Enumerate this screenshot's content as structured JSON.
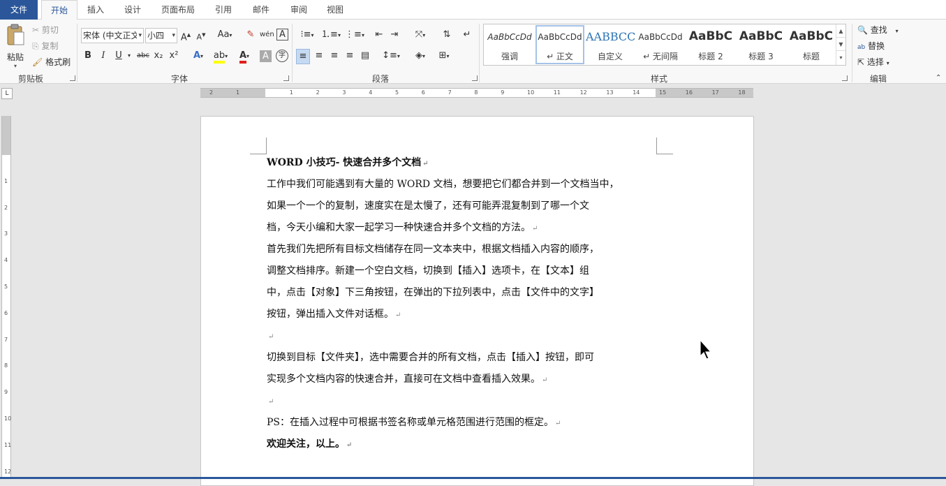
{
  "tabs": [
    {
      "label": "文件"
    },
    {
      "label": "开始"
    },
    {
      "label": "插入"
    },
    {
      "label": "设计"
    },
    {
      "label": "页面布局"
    },
    {
      "label": "引用"
    },
    {
      "label": "邮件"
    },
    {
      "label": "审阅"
    },
    {
      "label": "视图"
    }
  ],
  "clipboard": {
    "paste": "粘贴",
    "cut": "剪切",
    "copy": "复制",
    "format_painter": "格式刷",
    "label": "剪贴板"
  },
  "font": {
    "name": "宋体 (中文正文",
    "size": "小四",
    "label": "字体",
    "bold": "B",
    "italic": "I",
    "underline": "U",
    "strike": "abc",
    "sub": "x₂",
    "sup": "x²"
  },
  "paragraph": {
    "label": "段落"
  },
  "styles": {
    "label": "样式",
    "items": [
      {
        "preview": "AaBbCcDd",
        "name": "强调"
      },
      {
        "preview": "AaBbCcDd",
        "name": "↵ 正文"
      },
      {
        "preview": "AABBCC",
        "name": "自定义"
      },
      {
        "preview": "AaBbCcDd",
        "name": "↵ 无间隔"
      },
      {
        "preview": "AaBbC",
        "name": "标题 2"
      },
      {
        "preview": "AaBbC",
        "name": "标题 3"
      },
      {
        "preview": "AaBbC",
        "name": "标题"
      }
    ]
  },
  "editing": {
    "find": "查找",
    "replace": "替换",
    "select": "选择",
    "label": "编辑"
  },
  "ruler": {
    "h_numbers": [
      "2",
      "1",
      "1",
      "2",
      "3",
      "4",
      "5",
      "6",
      "7",
      "8",
      "9",
      "10",
      "11",
      "12",
      "13",
      "14",
      "15",
      "16",
      "17",
      "18"
    ],
    "v_numbers": [
      "1",
      "2",
      "3",
      "4",
      "5",
      "6",
      "7",
      "8",
      "9",
      "10",
      "11",
      "12"
    ]
  },
  "document": {
    "title": "WORD 小技巧- 快速合并多个文档",
    "lines": [
      "工作中我们可能遇到有大量的 WORD 文档，想要把它们都合并到一个文档当中，",
      "如果一个一个的复制，速度实在是太慢了，还有可能弄混复制到了哪一个文",
      "档，今天小编和大家一起学习一种快速合并多个文档的方法。",
      "首先我们先把所有目标文档储存在同一文本夹中，根据文档插入内容的顺序，",
      "调整文档排序。新建一个空白文档，切换到【插入】选项卡，在【文本】组",
      "中，点击【对象】下三角按钮，在弹出的下拉列表中，点击【文件中的文字】",
      "按钮，弹出插入文件对话框。",
      "",
      "切换到目标【文件夹】，选中需要合并的所有文档，点击【插入】按钮，即可",
      "实现多个文档内容的快速合并，直接可在文档中查看插入效果。",
      "",
      "PS：在插入过程中可根据书签名称或单元格范围进行范围的框定。",
      "欢迎关注，以上。"
    ],
    "mark_lines": [
      2,
      6,
      7,
      9,
      10,
      11,
      12
    ]
  },
  "colors": {
    "accent": "#2b579a",
    "highlight": "#ffff00",
    "font_color": "#e0201c"
  }
}
